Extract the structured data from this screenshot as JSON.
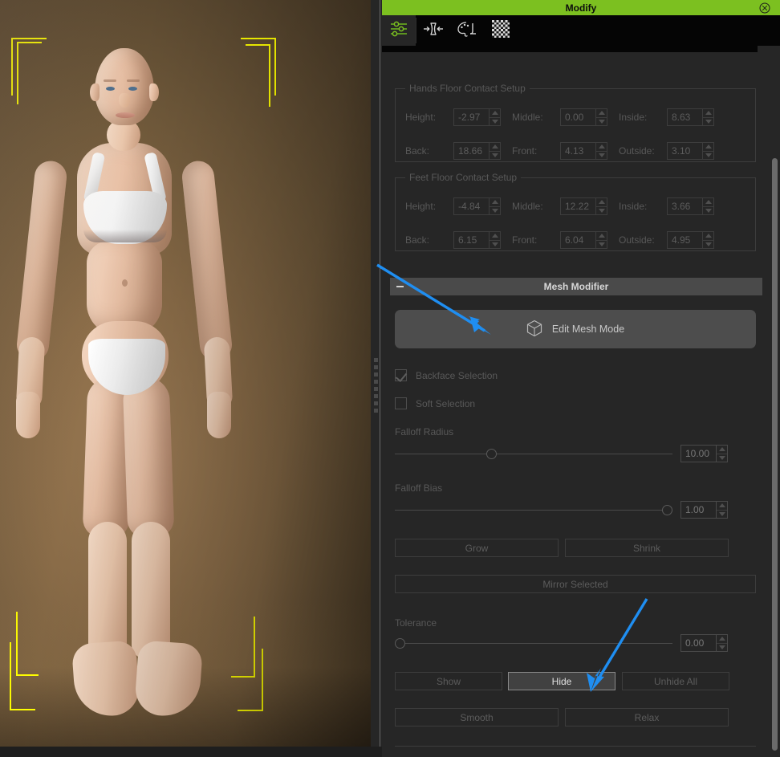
{
  "window": {
    "title": "Modify",
    "close_icon": "close-circle-icon"
  },
  "toolbar": {
    "items": [
      {
        "name": "sliders-parameters-icon",
        "label": "Parameters",
        "active": true
      },
      {
        "name": "shaping-icon",
        "label": "Shaping",
        "active": false
      },
      {
        "name": "surfaces-palette-icon",
        "label": "Surfaces",
        "active": false
      },
      {
        "name": "checker-pattern-icon",
        "label": "Geometry Editor",
        "active": false
      }
    ]
  },
  "hands_group": {
    "title": "Hands Floor Contact Setup",
    "fields": [
      {
        "label": "Height:",
        "value": "-2.97"
      },
      {
        "label": "Middle:",
        "value": "0.00"
      },
      {
        "label": "Inside:",
        "value": "8.63"
      },
      {
        "label": "Back:",
        "value": "18.66"
      },
      {
        "label": "Front:",
        "value": "4.13"
      },
      {
        "label": "Outside:",
        "value": "3.10"
      }
    ]
  },
  "feet_group": {
    "title": "Feet Floor Contact Setup",
    "fields": [
      {
        "label": "Height:",
        "value": "-4.84"
      },
      {
        "label": "Middle:",
        "value": "12.22"
      },
      {
        "label": "Inside:",
        "value": "3.66"
      },
      {
        "label": "Back:",
        "value": "6.15"
      },
      {
        "label": "Front:",
        "value": "6.04"
      },
      {
        "label": "Outside:",
        "value": "4.95"
      }
    ]
  },
  "mesh_modifier": {
    "header": "Mesh Modifier",
    "edit_mesh_mode": {
      "label": "Edit Mesh Mode",
      "icon": "cube-icon"
    },
    "backface_selection": {
      "label": "Backface Selection",
      "checked": true
    },
    "soft_selection": {
      "label": "Soft Selection",
      "checked": false
    },
    "falloff_radius": {
      "label": "Falloff Radius",
      "value": "10.00",
      "knob_percent": 33
    },
    "falloff_bias": {
      "label": "Falloff Bias",
      "value": "1.00",
      "knob_percent": 100
    },
    "grow_button": "Grow",
    "shrink_button": "Shrink",
    "mirror_selected_button": "Mirror Selected",
    "tolerance": {
      "label": "Tolerance",
      "value": "0.00",
      "knob_percent": 0
    },
    "show_button": "Show",
    "hide_button": "Hide",
    "unhide_all_button": "Unhide All",
    "smooth_button": "Smooth",
    "relax_button": "Relax"
  },
  "colors": {
    "title_bar": "#7cc020",
    "panel_bg": "#262626",
    "toolbar_bg": "#050505",
    "annotation_arrow": "#1f8ef1",
    "selection_bracket": "#ffff00",
    "highlight_button_bg": "#414141"
  },
  "annotations": [
    {
      "name": "arrow-to-edit-mesh-mode",
      "color": "#1f8ef1"
    },
    {
      "name": "arrow-to-hide-button",
      "color": "#1f8ef1"
    }
  ],
  "viewport": {
    "label": "3D character viewport",
    "selection_brackets": 4
  },
  "scrollbar": {
    "orientation": "vertical"
  }
}
